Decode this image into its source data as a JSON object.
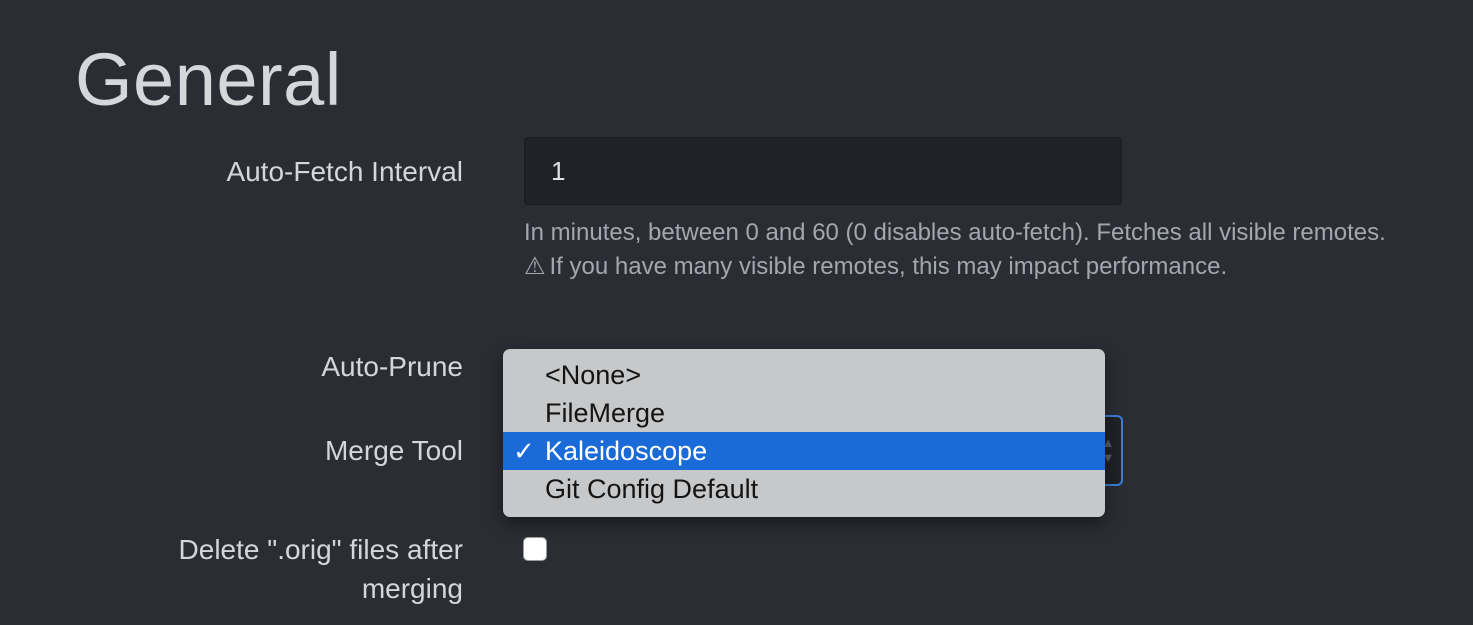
{
  "page": {
    "title": "General"
  },
  "auto_fetch": {
    "label": "Auto-Fetch Interval",
    "value": "1",
    "help_line1": "In minutes, between 0 and 60 (0 disables auto-fetch). Fetches all visible remotes.",
    "warning_icon": "⚠",
    "help_line2": "If you have many visible remotes, this may impact performance."
  },
  "auto_prune": {
    "label": "Auto-Prune"
  },
  "merge_tool": {
    "label": "Merge Tool",
    "selected": "Kaleidoscope",
    "options": [
      "<None>",
      "FileMerge",
      "Kaleidoscope",
      "Git Config Default"
    ],
    "check_mark": "✓",
    "arrow_up": "▲",
    "arrow_down": "▼"
  },
  "delete_orig": {
    "label_line1": "Delete \".orig\" files after",
    "label_line2": "merging",
    "checked": false
  },
  "colors": {
    "background": "#2b2d34",
    "accent": "#1a6bd7",
    "focus_border": "#3b7fd9",
    "dropdown_bg": "#c7c8ca"
  }
}
